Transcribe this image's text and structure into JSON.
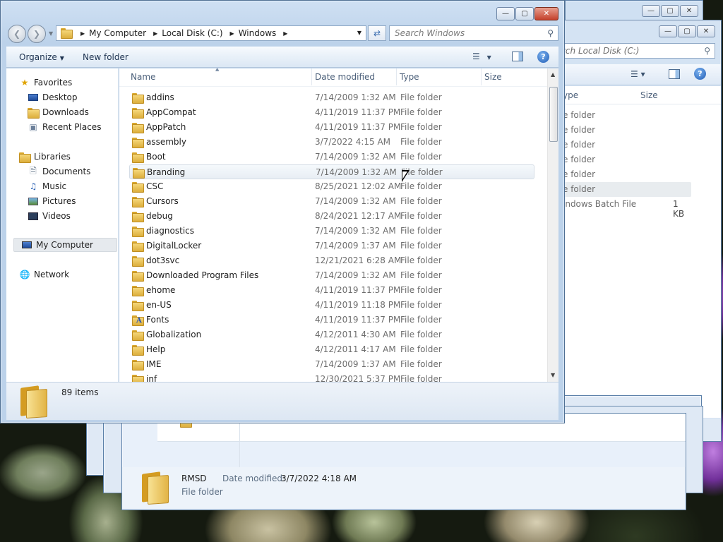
{
  "main": {
    "address": [
      "My Computer",
      "Local Disk (C:)",
      "Windows"
    ],
    "search_placeholder": "Search Windows",
    "toolbar": {
      "organize": "Organize",
      "new_folder": "New folder",
      "help": "?"
    },
    "nav": {
      "favorites": "Favorites",
      "desktop": "Desktop",
      "downloads": "Downloads",
      "recent": "Recent Places",
      "libraries": "Libraries",
      "documents": "Documents",
      "music": "Music",
      "pictures": "Pictures",
      "videos": "Videos",
      "computer": "My Computer",
      "network": "Network"
    },
    "columns": {
      "name": "Name",
      "date": "Date modified",
      "type": "Type",
      "size": "Size"
    },
    "files": [
      {
        "name": "addins",
        "date": "7/14/2009 1:32 AM",
        "type": "File folder"
      },
      {
        "name": "AppCompat",
        "date": "4/11/2019 11:37 PM",
        "type": "File folder"
      },
      {
        "name": "AppPatch",
        "date": "4/11/2019 11:37 PM",
        "type": "File folder"
      },
      {
        "name": "assembly",
        "date": "3/7/2022 4:15 AM",
        "type": "File folder"
      },
      {
        "name": "Boot",
        "date": "7/14/2009 1:32 AM",
        "type": "File folder"
      },
      {
        "name": "Branding",
        "date": "7/14/2009 1:32 AM",
        "type": "File folder"
      },
      {
        "name": "CSC",
        "date": "8/25/2021 12:02 AM",
        "type": "File folder"
      },
      {
        "name": "Cursors",
        "date": "7/14/2009 1:32 AM",
        "type": "File folder"
      },
      {
        "name": "debug",
        "date": "8/24/2021 12:17 AM",
        "type": "File folder"
      },
      {
        "name": "diagnostics",
        "date": "7/14/2009 1:32 AM",
        "type": "File folder"
      },
      {
        "name": "DigitalLocker",
        "date": "7/14/2009 1:37 AM",
        "type": "File folder"
      },
      {
        "name": "dot3svc",
        "date": "12/21/2021 6:28 AM",
        "type": "File folder"
      },
      {
        "name": "Downloaded Program Files",
        "date": "7/14/2009 1:32 AM",
        "type": "File folder"
      },
      {
        "name": "ehome",
        "date": "4/11/2019 11:37 PM",
        "type": "File folder"
      },
      {
        "name": "en-US",
        "date": "4/11/2019 11:18 PM",
        "type": "File folder"
      },
      {
        "name": "Fonts",
        "date": "4/11/2019 11:37 PM",
        "type": "File folder"
      },
      {
        "name": "Globalization",
        "date": "4/12/2011 4:30 AM",
        "type": "File folder"
      },
      {
        "name": "Help",
        "date": "4/12/2011 4:17 AM",
        "type": "File folder"
      },
      {
        "name": "IME",
        "date": "7/14/2009 1:37 AM",
        "type": "File folder"
      },
      {
        "name": "inf",
        "date": "12/30/2021 5:37 PM",
        "type": "File folder"
      }
    ],
    "status_count": "89 items"
  },
  "back_window": {
    "search_placeholder": "rch Local Disk (C:)",
    "col_type": "ype",
    "col_size": "Size",
    "rows": [
      {
        "type": "e folder",
        "size": ""
      },
      {
        "type": "e folder",
        "size": ""
      },
      {
        "type": "e folder",
        "size": ""
      },
      {
        "type": "e folder",
        "size": ""
      },
      {
        "type": "e folder",
        "size": ""
      },
      {
        "type": "e folder",
        "size": ""
      },
      {
        "type": "indows Batch File",
        "size": "1 KB"
      }
    ]
  },
  "bottom_window": {
    "ghost_row_type": "File folder",
    "details_name": "RMSD",
    "date_modified_label": "Date modified:",
    "date_modified_value": "3/7/2022 4:18 AM",
    "details_kind": "File folder"
  }
}
